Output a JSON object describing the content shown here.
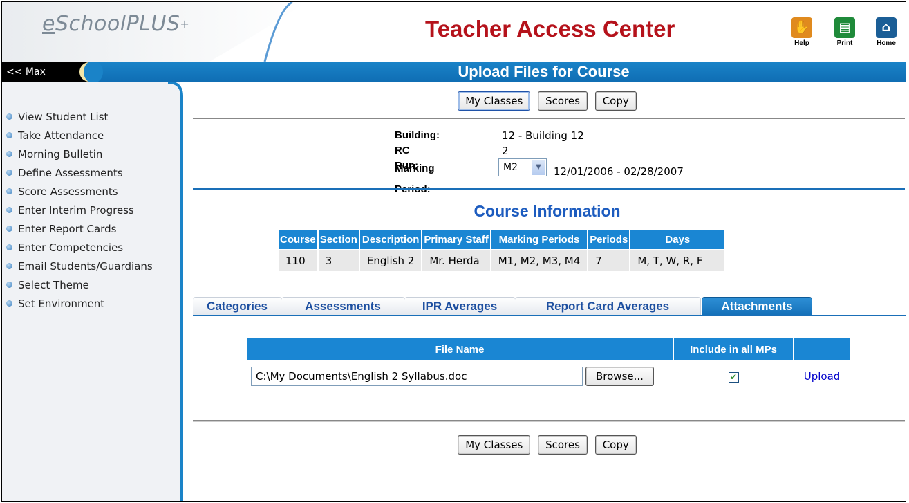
{
  "header": {
    "logo_e": "e",
    "logo_text": "SchoolPLUS",
    "logo_plus": "+",
    "app_title": "Teacher Access Center",
    "icons": [
      {
        "name": "help-icon",
        "label": "Help",
        "color": "#e08a1e",
        "glyph": "✋"
      },
      {
        "name": "print-icon",
        "label": "Print",
        "color": "#1f8a3a",
        "glyph": "▤"
      },
      {
        "name": "home-icon",
        "label": "Home",
        "color": "#1b5e96",
        "glyph": "⌂"
      }
    ]
  },
  "bar": {
    "max_label": "<< Max",
    "page_title": "Upload Files for Course"
  },
  "sidebar": {
    "items": [
      {
        "label": "View Student List"
      },
      {
        "label": "Take Attendance"
      },
      {
        "label": "Morning Bulletin"
      },
      {
        "label": "Define Assessments"
      },
      {
        "label": "Score Assessments"
      },
      {
        "label": "Enter Interim Progress"
      },
      {
        "label": "Enter Report Cards"
      },
      {
        "label": "Enter Competencies"
      },
      {
        "label": "Email Students/Guardians"
      },
      {
        "label": "Select Theme"
      },
      {
        "label": "Set Environment"
      }
    ]
  },
  "buttons": {
    "my_classes": "My Classes",
    "scores": "Scores",
    "copy": "Copy"
  },
  "info": {
    "building_label": "Building:",
    "building_value": "12 - Building 12",
    "rc_run_label": "RC Run:",
    "rc_run_value": "2",
    "marking_period_label": "Marking Period:",
    "marking_period_value": "M2",
    "marking_period_dates": "12/01/2006 - 02/28/2007"
  },
  "course_info": {
    "title": "Course Information",
    "headers": [
      "Course",
      "Section",
      "Description",
      "Primary Staff",
      "Marking Periods",
      "Periods",
      "Days"
    ],
    "row": [
      "110",
      "3",
      "English 2",
      "Mr. Herda",
      "M1, M2, M3, M4",
      "7",
      "M, T, W, R, F"
    ]
  },
  "tabs": [
    {
      "label": "Categories",
      "active": false
    },
    {
      "label": "Assessments",
      "active": false
    },
    {
      "label": "IPR Averages",
      "active": false
    },
    {
      "label": "Report Card Averages",
      "active": false
    },
    {
      "label": "Attachments",
      "active": true
    }
  ],
  "attachments": {
    "col_file_name": "File Name",
    "col_include": "Include in all MPs",
    "file_path": "C:\\My Documents\\English 2 Syllabus.doc",
    "browse_label": "Browse...",
    "include_checked": true,
    "upload_label": "Upload"
  },
  "colors": {
    "title_red": "#b5121b",
    "accent_blue": "#1a86d3",
    "link_blue": "#0000cc"
  }
}
